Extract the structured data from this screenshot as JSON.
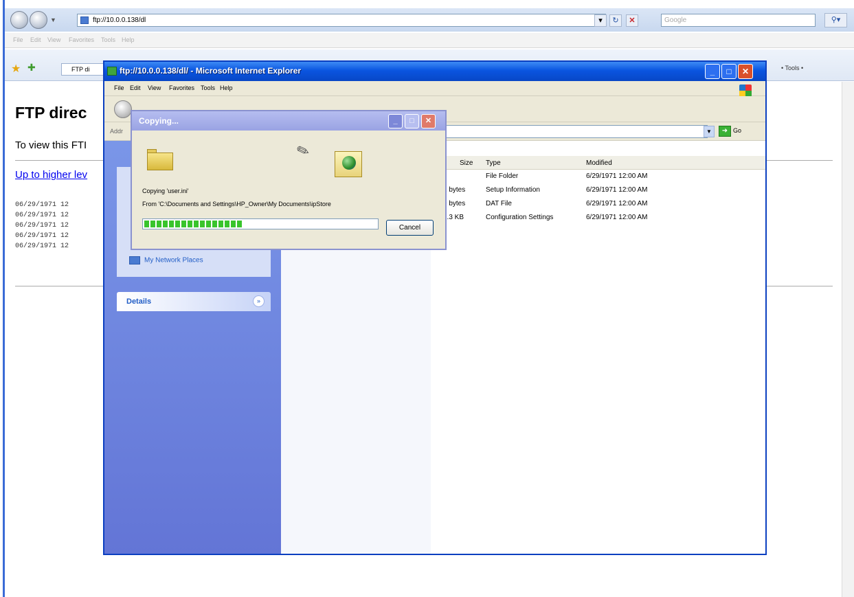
{
  "outer_browser": {
    "address": "ftp://10.0.0.138/dl",
    "search_placeholder": "Google",
    "menu": [
      "File",
      "Edit",
      "View",
      "Favorites",
      "Tools",
      "Help"
    ],
    "tab_label": "FTP di",
    "tools_label": "• Tools •"
  },
  "ftp_page": {
    "heading": "FTP direc",
    "view_text": "To view this FTI",
    "up_link": "Up to higher lev",
    "listing": [
      "06/29/1971 12",
      "06/29/1971 12",
      "06/29/1971 12",
      "06/29/1971 12",
      "06/29/1971 12"
    ]
  },
  "explorer": {
    "title": "ftp://10.0.0.138/dl/ - Microsoft Internet Explorer",
    "menu": [
      "File",
      "Edit",
      "View",
      "Favorites",
      "Tools",
      "Help"
    ],
    "address_label": "Addr",
    "go_label": "Go",
    "left_pane": {
      "network_places": "My Network Places",
      "details": "Details"
    },
    "columns": {
      "size": "Size",
      "type": "Type",
      "modified": "Modified"
    },
    "files": [
      {
        "size": "",
        "type": "File Folder",
        "modified": "6/29/1971 12:00 AM"
      },
      {
        "size": "2 bytes",
        "type": "Setup Information",
        "modified": "6/29/1971 12:00 AM"
      },
      {
        "size": "9 bytes",
        "type": "DAT File",
        "modified": "6/29/1971 12:00 AM"
      },
      {
        "size": "2.3 KB",
        "type": "Configuration Settings",
        "modified": "6/29/1971 12:00 AM"
      }
    ]
  },
  "copy_dialog": {
    "title": "Copying...",
    "copying_text": "Copying 'user.ini'",
    "from_text": "From 'C:\\Documents and Settings\\HP_Owner\\My Documents\\ipStore",
    "progress": 0.42,
    "cancel_label": "Cancel"
  }
}
